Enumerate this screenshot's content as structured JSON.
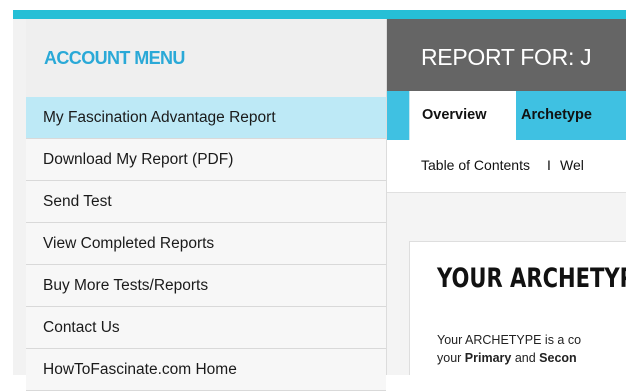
{
  "colors": {
    "accent": "#26bfd6",
    "menu_title": "#2aa9d7",
    "active_item": "#bde9f6",
    "header_bg": "#656565",
    "tab_bar": "#3fc1e2"
  },
  "sidebar": {
    "title": "ACCOUNT MENU",
    "items": [
      {
        "label": "My Fascination Advantage Report",
        "active": true
      },
      {
        "label": "Download My Report (PDF)"
      },
      {
        "label": "Send Test"
      },
      {
        "label": "View Completed Reports"
      },
      {
        "label": "Buy More Tests/Reports"
      },
      {
        "label": "Contact Us"
      },
      {
        "label": "HowToFascinate.com Home"
      }
    ]
  },
  "main": {
    "report_title": "REPORT FOR: J",
    "tabs": [
      {
        "label": "Overview",
        "active": true
      },
      {
        "label": "Archetype"
      }
    ],
    "toc": [
      {
        "label": "Table of Contents"
      },
      {
        "label": "Wel"
      }
    ],
    "toc_separator": "I",
    "card": {
      "title": "YOUR ARCHETYP",
      "line1": "Your ARCHETYPE is a co",
      "line2_prefix": "your ",
      "line2_bold1": "Primary",
      "line2_mid": " and ",
      "line2_bold2": "Secon"
    }
  }
}
